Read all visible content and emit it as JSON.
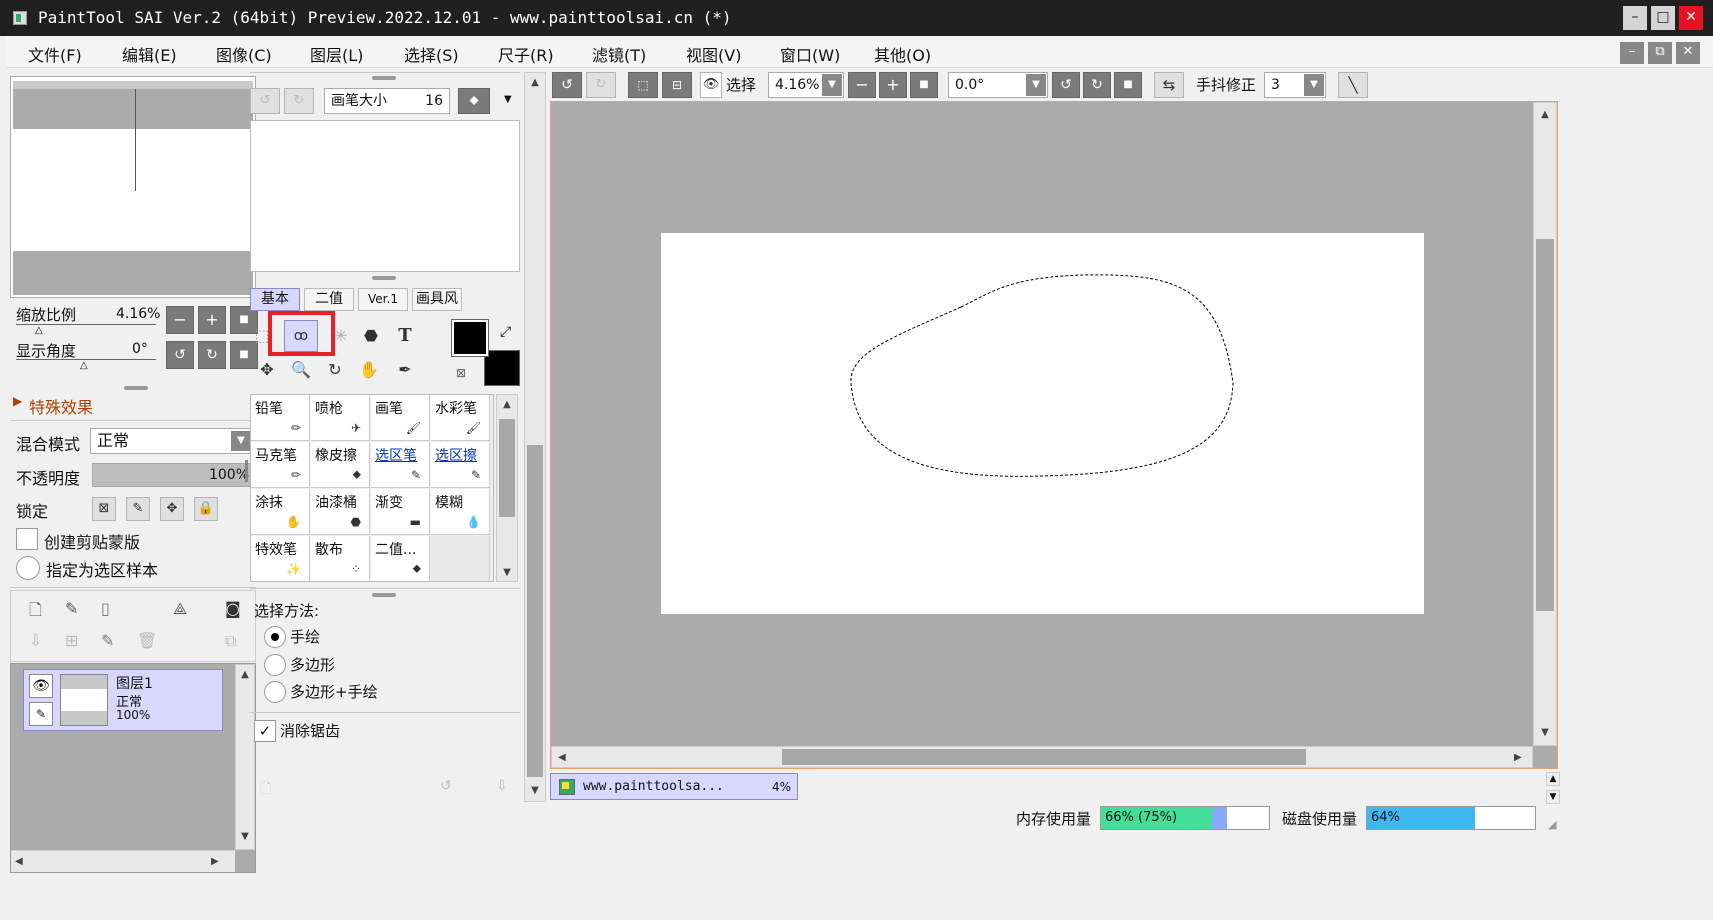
{
  "window": {
    "title": "PaintTool SAI Ver.2 (64bit) Preview.2022.12.01 - www.painttoolsai.cn (*)"
  },
  "menu": [
    "文件(F)",
    "编辑(E)",
    "图像(C)",
    "图层(L)",
    "选择(S)",
    "尺子(R)",
    "滤镜(T)",
    "视图(V)",
    "窗口(W)",
    "其他(O)"
  ],
  "navigator": {
    "zoom_label": "缩放比例",
    "zoom_value": "4.16%",
    "angle_label": "显示角度",
    "angle_value": "0°"
  },
  "effects": {
    "label": "特殊效果"
  },
  "layer_props": {
    "blend_label": "混合模式",
    "blend_value": "正常",
    "opacity_label": "不透明度",
    "opacity_value": "100%",
    "opacity_fraction": 1.0,
    "lock_label": "锁定",
    "clip_label": "创建剪贴蒙版",
    "sample_label": "指定为选区样本"
  },
  "layers": [
    {
      "name": "图层1",
      "mode": "正常",
      "opacity": "100%"
    }
  ],
  "brush_panel": {
    "size_label": "画笔大小",
    "size_value": "16"
  },
  "tool_tabs": [
    "基本",
    "二值",
    "Ver.1",
    "画具风"
  ],
  "active_tool_tab": 0,
  "brushes": [
    "铅笔",
    "喷枪",
    "画笔",
    "水彩笔",
    "马克笔",
    "橡皮擦",
    "选区笔",
    "选区擦",
    "涂抹",
    "油漆桶",
    "渐变",
    "模糊",
    "特效笔",
    "散布",
    "二值..."
  ],
  "highlighted_brushes": [
    "选区笔",
    "选区擦"
  ],
  "select_method": {
    "label": "选择方法:",
    "options": [
      "手绘",
      "多边形",
      "多边形+手绘"
    ],
    "selected": 0,
    "antialias_label": "消除锯齿",
    "antialias_checked": true
  },
  "toolbar": {
    "select_label": "选择",
    "zoom_value": "4.16%",
    "angle_value": "0.0°",
    "stabilizer_label": "手抖修正",
    "stabilizer_value": "3"
  },
  "document_tab": {
    "name": "www.painttoolsa...",
    "zoom": "4%"
  },
  "status": {
    "memory_label": "内存使用量",
    "memory_value": "66% (75%)",
    "memory_fraction": 0.66,
    "memory_peak_fraction": 0.75,
    "disk_label": "磁盘使用量",
    "disk_value": "64%",
    "disk_fraction": 0.64
  },
  "colors": {
    "canvas_bg": "#ababab",
    "selection_tab": "#d8d8ff",
    "highlight_box": "#e8202a",
    "memory_bar": "#44dd99",
    "memory_peak": "#8aa8ff",
    "disk_bar": "#3fb8f0"
  }
}
